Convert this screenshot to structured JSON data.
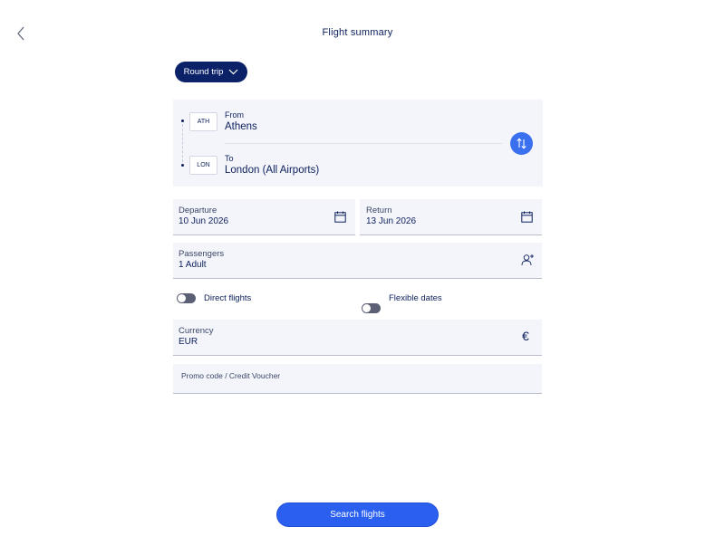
{
  "header": {
    "title": "Flight summary"
  },
  "trip_type": {
    "label": "Round trip"
  },
  "route": {
    "from": {
      "code": "ATH",
      "label": "From",
      "city": "Athens"
    },
    "to": {
      "code": "LON",
      "label": "To",
      "city": "London (All Airports)"
    }
  },
  "dates": {
    "departure": {
      "label": "Departure",
      "value": "10 Jun 2026"
    },
    "return": {
      "label": "Return",
      "value": "13 Jun 2026"
    }
  },
  "passengers": {
    "label": "Passengers",
    "value": "1 Adult"
  },
  "options": {
    "direct_flights": {
      "label": "Direct flights",
      "enabled": false
    },
    "flexible_dates": {
      "label": "Flexible dates",
      "enabled": false
    }
  },
  "currency": {
    "label": "Currency",
    "value": "EUR",
    "symbol": "€"
  },
  "promo": {
    "placeholder": "Promo code / Credit Voucher"
  },
  "actions": {
    "search_label": "Search flights"
  },
  "colors": {
    "navy": "#0b2269",
    "accent_blue": "#2a5ff0",
    "field_bg": "#f4f5fb"
  }
}
